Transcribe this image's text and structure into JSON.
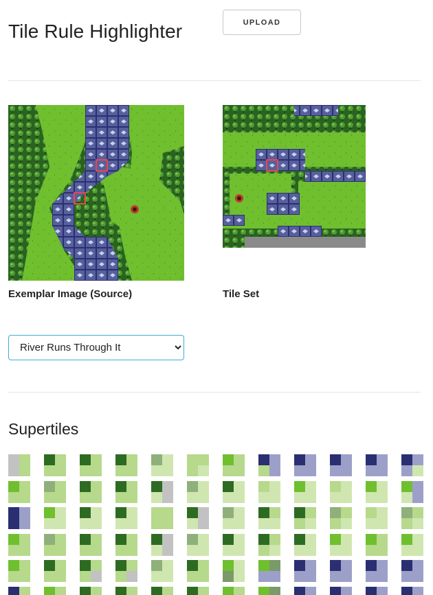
{
  "app": {
    "title": "Tile Rule Highlighter"
  },
  "toolbar": {
    "upload_label": "UPLOAD"
  },
  "exemplar": {
    "caption": "Exemplar Image (Source)"
  },
  "tileset": {
    "caption": "Tile Set"
  },
  "preset_select": {
    "selected": "River Runs Through It",
    "options": [
      "River Runs Through It"
    ]
  },
  "supertiles": {
    "title": "Supertiles"
  },
  "colors": {
    "light_grass": "#6fbf2f",
    "dark_grass": "#2e6b22",
    "forest": "#275c1d",
    "water": "#2a2f72",
    "water_light": "#6e78b8",
    "highlight": "#e8474c",
    "gray": "#8a8a8a"
  }
}
